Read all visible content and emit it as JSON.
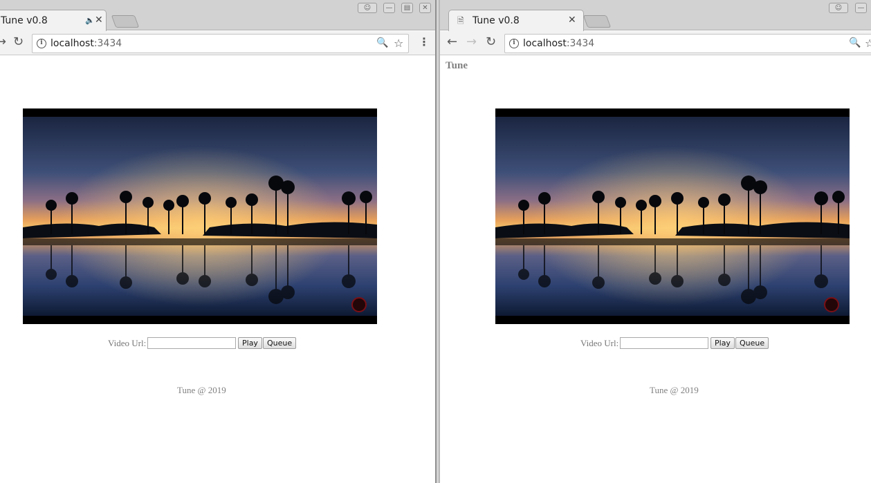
{
  "browser": {
    "tab_title": "Tune v0.8",
    "url_host": "localhost",
    "url_port": ":3434"
  },
  "page": {
    "brand": "Tune",
    "form": {
      "label": "Video Url:",
      "input_value": "",
      "play_label": "Play",
      "queue_label": "Queue"
    },
    "footer": "Tune @ 2019"
  },
  "icons": {
    "close": "close-icon",
    "audio": "speaker-icon",
    "back": "back-arrow-icon",
    "forward": "forward-arrow-icon",
    "reload": "reload-icon",
    "info": "info-icon",
    "zoom": "zoom-icon",
    "star": "star-icon",
    "menu": "menu-icon",
    "profile": "profile-icon",
    "document": "document-icon"
  },
  "colors": {
    "chrome_frame": "#d2d2d2",
    "toolbar": "#f2f2f2",
    "page_text": "#808080"
  }
}
